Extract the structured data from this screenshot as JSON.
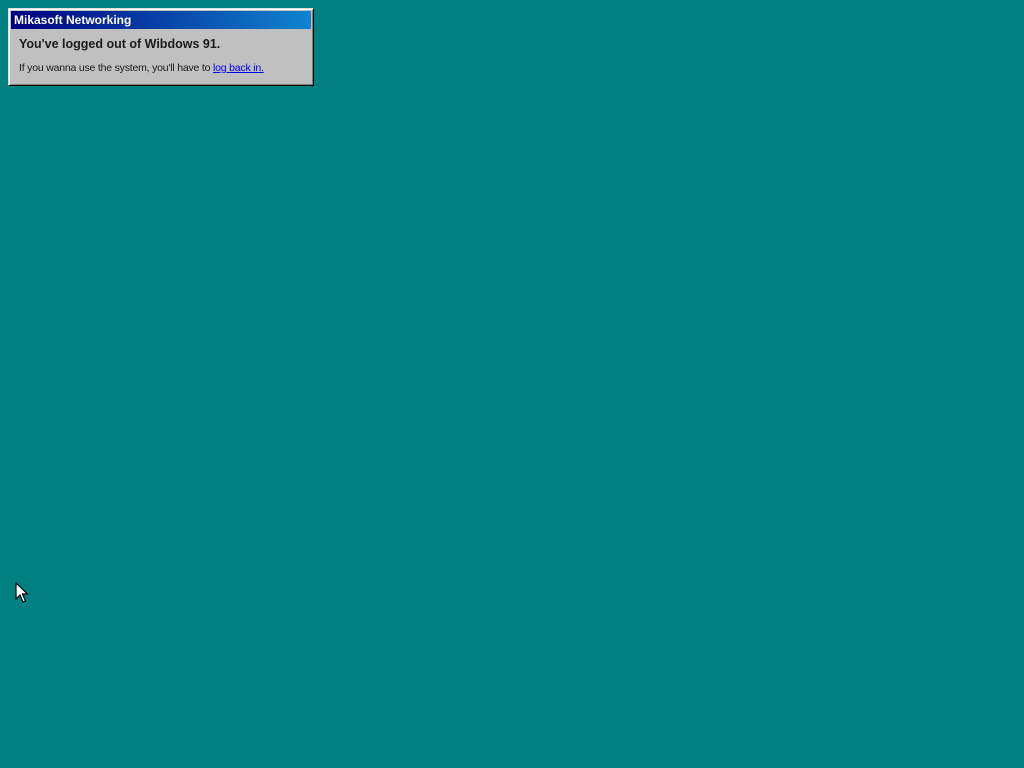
{
  "desktop": {
    "background_color": "#008080"
  },
  "window": {
    "title": "Mikasoft Networking",
    "heading": "You've logged out of Wibdows 91.",
    "message_prefix": "If you wanna use the system, you'll have to ",
    "link_text": "log back in.",
    "titlebar_colors": [
      "#000080",
      "#1084d0"
    ],
    "link_color": "#0000ee"
  },
  "cursor": {
    "icon": "arrow-cursor-icon"
  }
}
